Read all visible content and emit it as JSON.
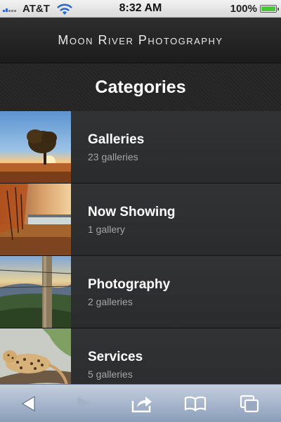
{
  "status_bar": {
    "carrier": "AT&T",
    "time": "8:32 AM",
    "battery": "100%",
    "battery_level": 1.0,
    "wifi_icon": "wifi-icon"
  },
  "header": {
    "site_title": "Moon River Photography"
  },
  "page": {
    "section_title": "Categories"
  },
  "categories": [
    {
      "title": "Galleries",
      "count": "23 galleries",
      "thumbnail": "tree-sunset"
    },
    {
      "title": "Now Showing",
      "count": "1 gallery",
      "thumbnail": "autumn-lake"
    },
    {
      "title": "Photography",
      "count": "2 galleries",
      "thumbnail": "fence-post-valley"
    },
    {
      "title": "Services",
      "count": "5 galleries",
      "thumbnail": "leopard-on-branch"
    }
  ],
  "toolbar": {
    "icons": [
      "back-icon",
      "forward-icon",
      "share-icon",
      "bookmarks-icon",
      "tabs-icon"
    ],
    "forward_enabled": false
  },
  "colors": {
    "battery": "#4bc63a",
    "signal": "#2a67c8",
    "toolbar_top": "#c4cfdf",
    "toolbar_bottom": "#8b9db9"
  }
}
